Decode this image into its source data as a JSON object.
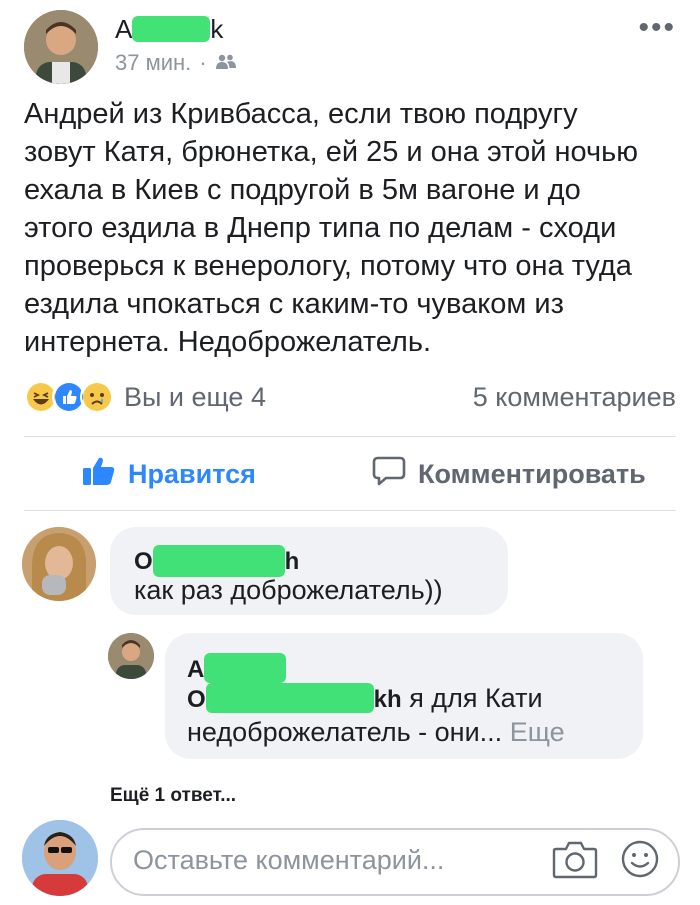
{
  "post": {
    "author_prefix": "A",
    "author_suffix": "k",
    "time": "37 мин.",
    "audience_icon": "friends-icon",
    "text": "Андрей из Кривбасса, если твою подругу\nзовут Катя, брюнетка, ей 25 и она этой ночью\nехала в Киев с подругой в 5м вагоне и до\nэтого ездила в Днепр типа по делам - сходи\nпроверься к венерологу, потому что она туда\nездила чпокаться с каким-то чуваком из\nинтернета. Недоброжелатель.",
    "more_icon": "ellipsis-icon"
  },
  "reactions": {
    "icons": [
      "haha-icon",
      "like-icon",
      "sad-icon"
    ],
    "text": "Вы и еще 4",
    "comments_count": "5 комментариев"
  },
  "actions": {
    "like_label": "Нравится",
    "comment_label": "Комментировать"
  },
  "comments": [
    {
      "name_prefix": "O",
      "name_suffix": "h",
      "text": "как раз доброжелатель))"
    },
    {
      "name_prefix": "A",
      "name_suffix": "",
      "mention_prefix": "O",
      "mention_suffix": "kh",
      "text_after_mention": " я для Кати",
      "text_line2": "недоброжелатель - они...",
      "more_label": "Еще"
    }
  ],
  "more_replies": "Ещё 1 ответ...",
  "composer": {
    "placeholder": "Оставьте комментарий...",
    "camera_icon": "camera-icon",
    "emoji_icon": "smile-icon"
  },
  "colors": {
    "link_blue": "#2d88ff",
    "muted": "#606770",
    "bubble_bg": "#f0f2f5",
    "mask_green": "#33e06b"
  }
}
